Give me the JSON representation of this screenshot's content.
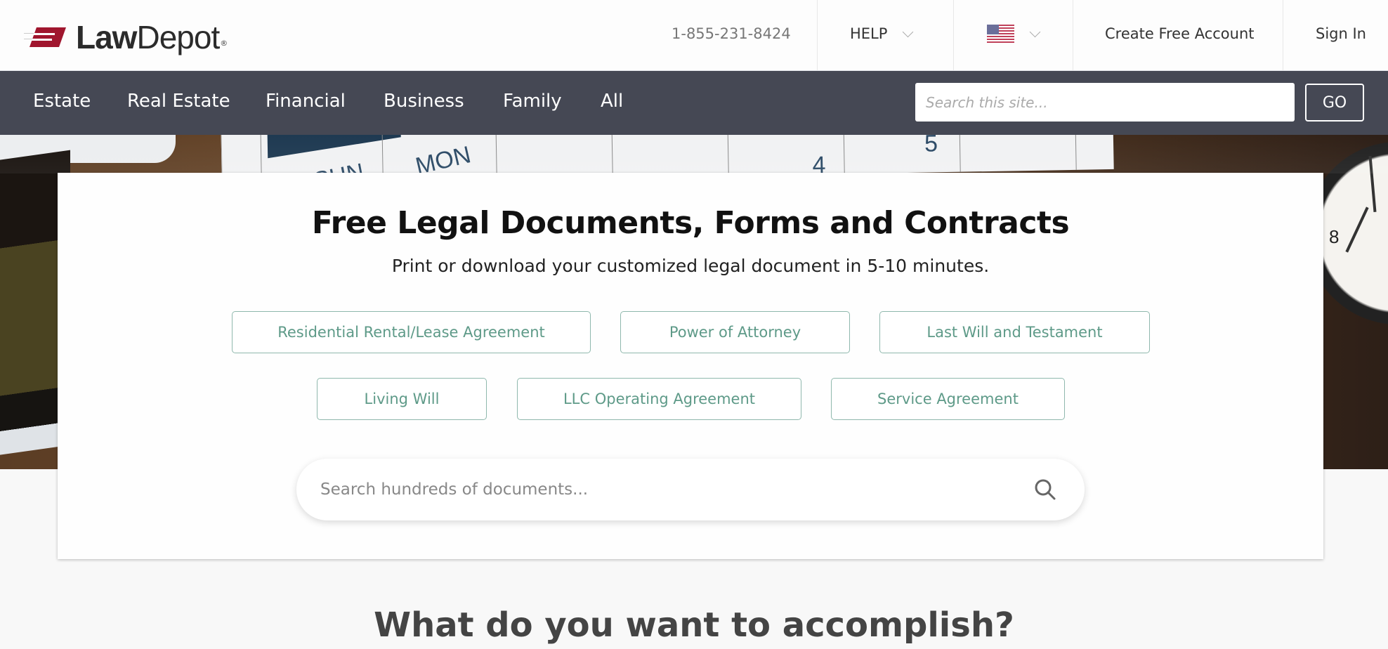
{
  "header": {
    "logo_text_bold": "Law",
    "logo_text_regular": "Depot",
    "logo_registered": "®",
    "logo_color": "#a0162e",
    "phone": "1-855-231-8424",
    "help_label": "HELP",
    "locale_icon": "us-flag-icon",
    "create_account_label": "Create Free Account",
    "sign_in_label": "Sign In"
  },
  "nav": {
    "background": "#454854",
    "items": [
      {
        "label": "Estate"
      },
      {
        "label": "Real Estate"
      },
      {
        "label": "Financial"
      },
      {
        "label": "Business"
      },
      {
        "label": "Family"
      },
      {
        "label": "All"
      }
    ],
    "search_placeholder": "Search this site...",
    "go_label": "GO"
  },
  "hero": {
    "calendar_labels": [
      "SUN",
      "MON",
      "4",
      "5"
    ],
    "clock_numbers": [
      "8"
    ],
    "title": "Free Legal Documents, Forms and Contracts",
    "subtitle": "Print or download your customized legal document in 5-10 minutes.",
    "accent_color": "#5e9a88",
    "documents_row1": [
      {
        "label": "Residential Rental/Lease Agreement"
      },
      {
        "label": "Power of Attorney"
      },
      {
        "label": "Last Will and Testament"
      }
    ],
    "documents_row2": [
      {
        "label": "Living Will"
      },
      {
        "label": "LLC Operating Agreement"
      },
      {
        "label": "Service Agreement"
      }
    ],
    "search_placeholder": "Search hundreds of documents..."
  },
  "section": {
    "heading": "What do you want to accomplish?"
  }
}
